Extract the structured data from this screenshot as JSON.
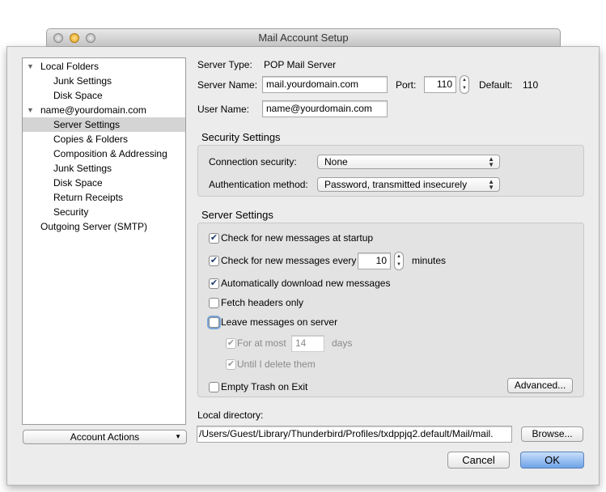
{
  "window": {
    "title": "Mail Account Setup"
  },
  "tree": [
    {
      "label": "Local Folders",
      "level": 0,
      "expanded": true
    },
    {
      "label": "Junk Settings",
      "level": 1
    },
    {
      "label": "Disk Space",
      "level": 1
    },
    {
      "label": "name@yourdomain.com",
      "level": 0,
      "expanded": true
    },
    {
      "label": "Server Settings",
      "level": 1,
      "selected": true
    },
    {
      "label": "Copies & Folders",
      "level": 1
    },
    {
      "label": "Composition & Addressing",
      "level": 1
    },
    {
      "label": "Junk Settings",
      "level": 1
    },
    {
      "label": "Disk Space",
      "level": 1
    },
    {
      "label": "Return Receipts",
      "level": 1
    },
    {
      "label": "Security",
      "level": 1
    },
    {
      "label": "Outgoing Server (SMTP)",
      "level": 0
    }
  ],
  "account_actions": "Account Actions",
  "server": {
    "type_label": "Server Type:",
    "type_value": "POP Mail Server",
    "name_label": "Server Name:",
    "name_value": "mail.yourdomain.com",
    "port_label": "Port:",
    "port_value": "110",
    "default_label": "Default:",
    "default_value": "110",
    "user_label": "User Name:",
    "user_value": "name@yourdomain.com"
  },
  "security": {
    "heading": "Security Settings",
    "conn_label": "Connection security:",
    "conn_value": "None",
    "auth_label": "Authentication method:",
    "auth_value": "Password, transmitted insecurely"
  },
  "settings": {
    "heading": "Server Settings",
    "startup": {
      "label": "Check for new messages at startup",
      "checked": true
    },
    "every": {
      "label": "Check for new messages every",
      "checked": true,
      "value": "10",
      "unit": "minutes"
    },
    "auto": {
      "label": "Automatically download new messages",
      "checked": true
    },
    "headers": {
      "label": "Fetch headers only",
      "checked": false
    },
    "leave": {
      "label": "Leave messages on server",
      "checked": false
    },
    "atmost": {
      "label": "For at most",
      "checked": true,
      "value": "14",
      "unit": "days"
    },
    "until": {
      "label": "Until I delete them",
      "checked": true
    },
    "trash": {
      "label": "Empty Trash on Exit",
      "checked": false
    },
    "advanced": "Advanced..."
  },
  "local": {
    "label": "Local directory:",
    "value": "/Users/Guest/Library/Thunderbird/Profiles/txdppjq2.default/Mail/mail.",
    "browse": "Browse..."
  },
  "cancel": "Cancel",
  "ok": "OK"
}
